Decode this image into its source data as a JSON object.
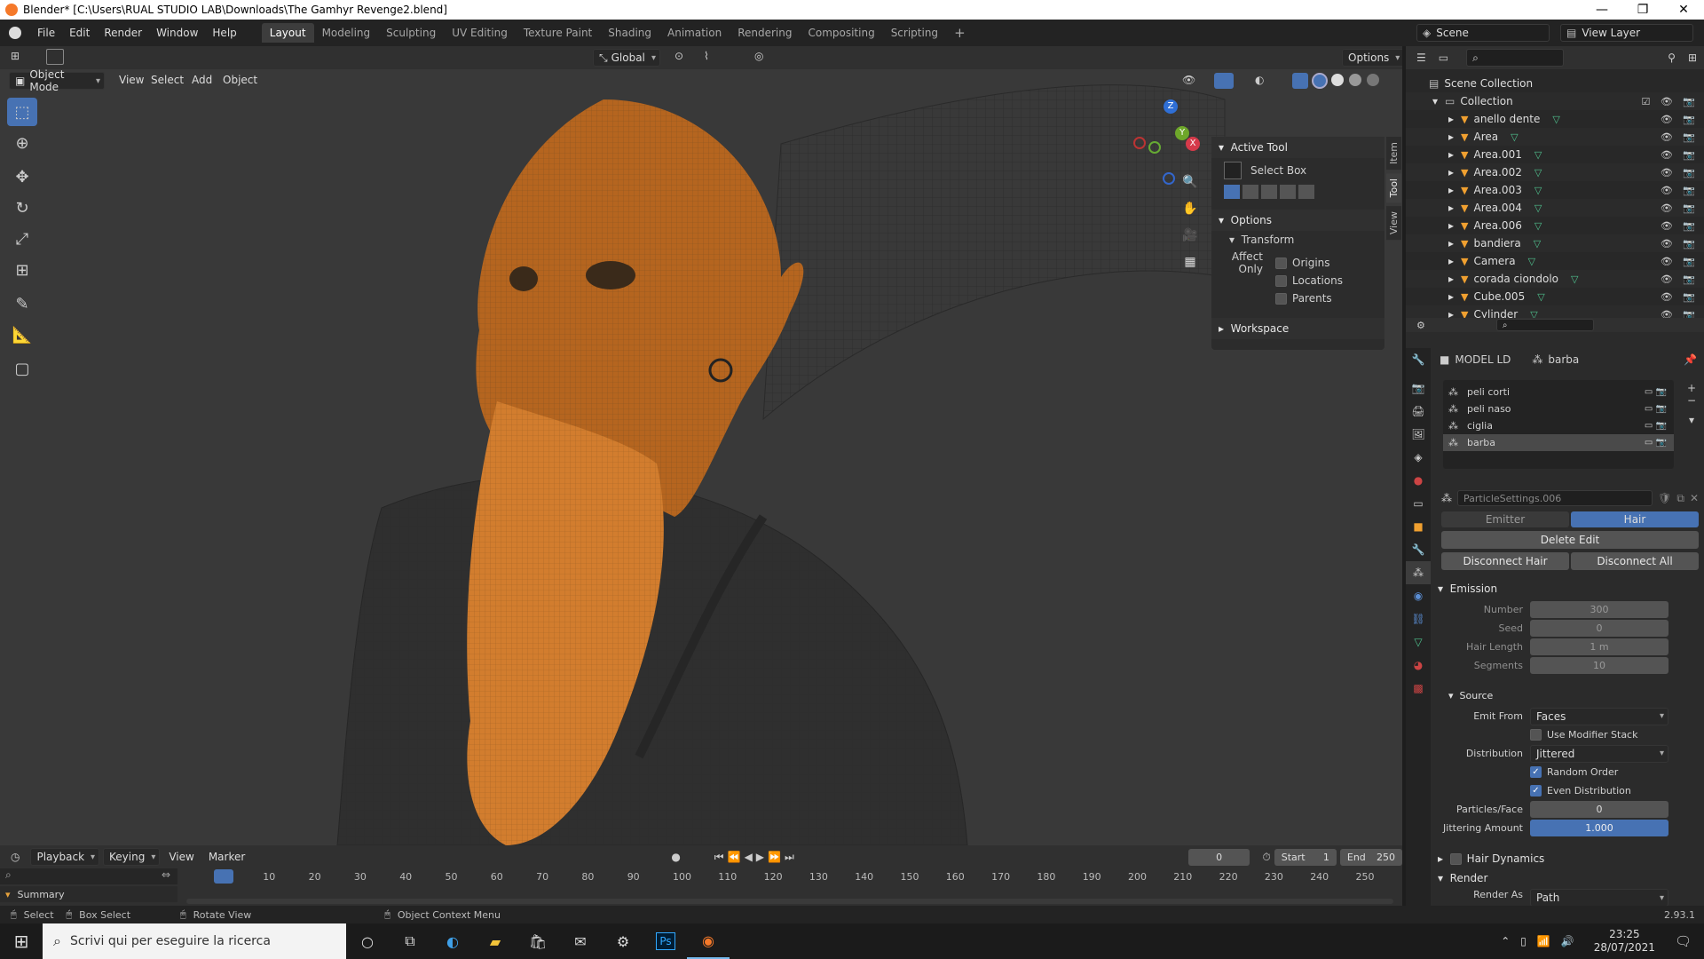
{
  "window": {
    "title": "Blender* [C:\\Users\\RUAL STUDIO LAB\\Downloads\\The Gamhyr Revenge2.blend]",
    "controls": [
      "—",
      "❐",
      "✕"
    ]
  },
  "menu": [
    "File",
    "Edit",
    "Render",
    "Window",
    "Help"
  ],
  "workspaces": [
    "Layout",
    "Modeling",
    "Sculpting",
    "UV Editing",
    "Texture Paint",
    "Shading",
    "Animation",
    "Rendering",
    "Compositing",
    "Scripting"
  ],
  "scene": {
    "label": "Scene",
    "view_layer": "View Layer"
  },
  "viewport": {
    "mode": "Object Mode",
    "menus": [
      "View",
      "Select",
      "Add",
      "Object"
    ],
    "orientation": "Global",
    "options": "Options",
    "gizmo_axes": [
      "Z",
      "Y",
      "X"
    ]
  },
  "npanel": {
    "active_tool": "Active Tool",
    "tool_name": "Select Box",
    "options": "Options",
    "transform": "Transform",
    "affect_only": "Affect Only",
    "origins": "Origins",
    "locations": "Locations",
    "parents": "Parents",
    "workspace": "Workspace",
    "tabs": [
      "Item",
      "Tool",
      "View"
    ]
  },
  "outliner": {
    "scene_collection": "Scene Collection",
    "collection": "Collection",
    "items": [
      "anello dente",
      "Area",
      "Area.001",
      "Area.002",
      "Area.003",
      "Area.004",
      "Area.006",
      "bandiera",
      "Camera",
      "corada ciondolo",
      "Cube.005",
      "Cylinder"
    ]
  },
  "properties": {
    "object": "MODEL LD",
    "system": "barba",
    "systems": [
      "peli corti",
      "peli naso",
      "ciglia",
      "barba"
    ],
    "settings": "ParticleSettings.006",
    "type_tabs": [
      "Emitter",
      "Hair"
    ],
    "delete_edit": "Delete Edit",
    "disconnect_hair": "Disconnect Hair",
    "disconnect_all": "Disconnect All",
    "emission": {
      "title": "Emission",
      "number_label": "Number",
      "number": "300",
      "seed_label": "Seed",
      "seed": "0",
      "hair_length_label": "Hair Length",
      "hair_length": "1 m",
      "segments_label": "Segments",
      "segments": "10"
    },
    "source": {
      "title": "Source",
      "emit_from_label": "Emit From",
      "emit_from": "Faces",
      "use_modifier_stack": "Use Modifier Stack",
      "distribution_label": "Distribution",
      "distribution": "Jittered",
      "random_order": "Random Order",
      "even_distribution": "Even Distribution",
      "particles_face_label": "Particles/Face",
      "particles_face": "0",
      "jittering_label": "Jittering Amount",
      "jittering": "1.000",
      "jittering_fraction": 1.0
    },
    "hair_dynamics": "Hair Dynamics",
    "render": "Render",
    "render_as_label": "Render As",
    "render_as": "Path"
  },
  "timeline": {
    "menus": [
      "Playback",
      "Keying",
      "View",
      "Marker"
    ],
    "current_frame": "0",
    "start_label": "Start",
    "start": "1",
    "end_label": "End",
    "end": "250",
    "summary": "Summary",
    "ticks": [
      "0",
      "10",
      "20",
      "30",
      "40",
      "50",
      "60",
      "70",
      "80",
      "90",
      "100",
      "110",
      "120",
      "130",
      "140",
      "150",
      "160",
      "170",
      "180",
      "190",
      "200",
      "210",
      "220",
      "230",
      "240",
      "250"
    ]
  },
  "status": {
    "select": "Select",
    "box_select": "Box Select",
    "rotate_view": "Rotate View",
    "context_menu": "Object Context Menu",
    "version": "2.93.1"
  },
  "taskbar": {
    "search_placeholder": "Scrivi qui per eseguire la ricerca",
    "time": "23:25",
    "date": "28/07/2021"
  },
  "colors": {
    "accent": "#4772b3",
    "wire": "#e8913a",
    "viewport_bg": "#393939"
  }
}
